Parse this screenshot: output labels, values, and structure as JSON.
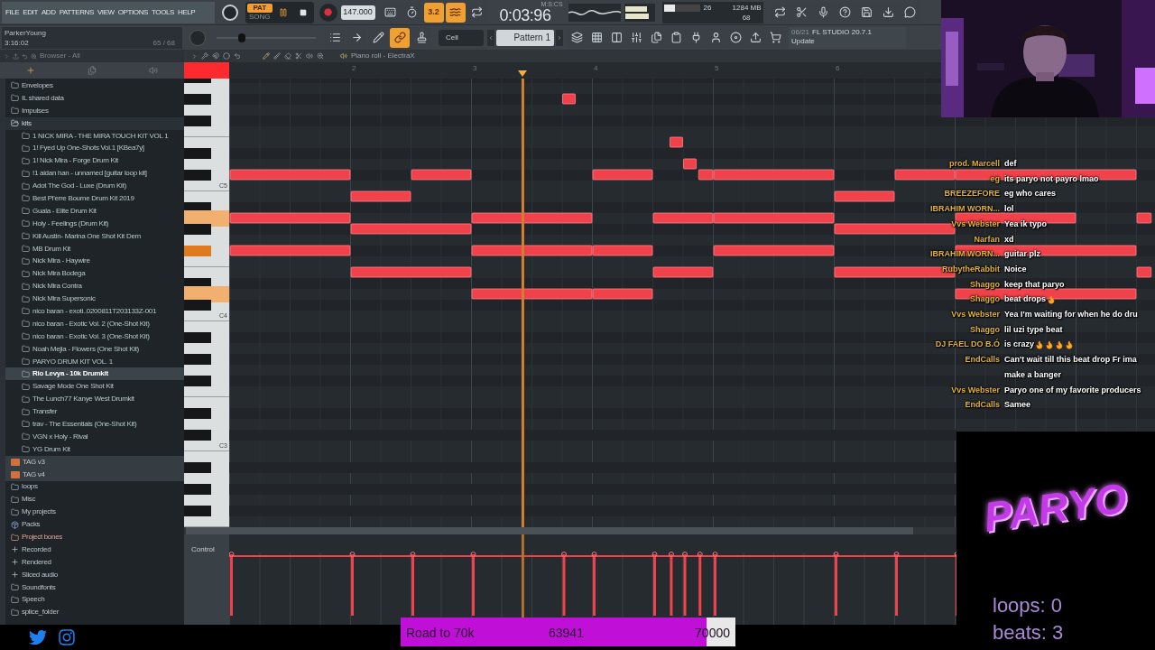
{
  "menu": [
    "FILE",
    "EDIT",
    "ADD",
    "PATTERNS",
    "VIEW",
    "OPTIONS",
    "TOOLS",
    "HELP"
  ],
  "transport": {
    "modes": [
      {
        "label": "PAT",
        "selected": true
      },
      {
        "label": "SONG",
        "selected": false
      }
    ],
    "playing": true,
    "recording": false,
    "tempo": "147.000",
    "time": "0:03:96",
    "time_unit": "M:S:CS"
  },
  "toolbar_left": [
    {
      "on": false
    },
    {
      "on": false
    },
    {
      "label": "3.2",
      "on": true
    },
    {
      "on": true
    },
    {
      "on": false
    }
  ],
  "cpu": {
    "level": 0.3,
    "cpu_value": "26",
    "memory": "1284 MB",
    "polyphony": "68"
  },
  "toolbar_right": [
    {
      "on": false
    },
    {
      "on": false
    },
    {
      "on": false
    },
    {
      "on": false
    },
    {
      "on": false
    },
    {
      "on": false
    },
    {
      "on": false
    }
  ],
  "hint": {
    "user": "ParkerYoung",
    "time": "3:16:02",
    "count": "65 / 68"
  },
  "pitch_slider": {
    "level": 0.25
  },
  "toolbar_row2": [
    {
      "on": false
    },
    {
      "on": false
    },
    {
      "on": false
    },
    {
      "on": true
    },
    {
      "on": false
    }
  ],
  "snap": "Cell",
  "pattern": "Pattern 1",
  "toolbar_row2_right": [
    {
      "on": false
    },
    {
      "on": false
    },
    {
      "on": false
    },
    {
      "on": false
    },
    {
      "on": false
    },
    {
      "on": false
    },
    {
      "on": false
    },
    {
      "on": false
    },
    {
      "on": false
    },
    {
      "on": false
    },
    {
      "on": false
    }
  ],
  "news": {
    "date": "06/21",
    "title": "FL STUDIO 20.7.1",
    "action": "Update"
  },
  "browser": {
    "title": "Browser - All",
    "items": [
      {
        "label": "Envelopes",
        "kind": "folder",
        "selected": false,
        "expanded": false
      },
      {
        "label": "IL shared data",
        "kind": "folder",
        "selected": false,
        "expanded": false
      },
      {
        "label": "Impulses",
        "kind": "folder",
        "selected": false,
        "expanded": false
      },
      {
        "label": "kits",
        "kind": "folder",
        "selected": false,
        "expanded": true,
        "children": [
          {
            "label": "1 NICK MIRA - THE MIRA TOUCH KIT VOL 1",
            "kind": "folder",
            "selected": false
          },
          {
            "label": "1! Fyed Up One-Shots Vol.1 [KBea7y]",
            "kind": "folder",
            "selected": false
          },
          {
            "label": "1! Nick Mira - Forge Drum Kit",
            "kind": "folder",
            "selected": false
          },
          {
            "label": "!1 aidan han - unnamed [guitar loop kit]",
            "kind": "folder",
            "selected": false
          },
          {
            "label": "Adot The God - Luxe (Drum Kit)",
            "kind": "folder",
            "selected": false
          },
          {
            "label": "Best Pi'erre Bourne Drum Kit 2019",
            "kind": "folder",
            "selected": false
          },
          {
            "label": "Guala - Elite Drum Kit",
            "kind": "folder",
            "selected": false
          },
          {
            "label": "Holy - Feelings (Drum Kit)",
            "kind": "folder",
            "selected": false
          },
          {
            "label": "Kill Austin- Marina One Shot Kit Dem",
            "kind": "folder",
            "selected": false
          },
          {
            "label": "MB Drum Kit",
            "kind": "folder",
            "selected": false
          },
          {
            "label": "Nick Mira - Haywire",
            "kind": "folder",
            "selected": false
          },
          {
            "label": "Nick Mira Bodega",
            "kind": "folder",
            "selected": false
          },
          {
            "label": "Nick Mira Contra",
            "kind": "folder",
            "selected": false
          },
          {
            "label": "Nick Mira Supersonic",
            "kind": "folder",
            "selected": false
          },
          {
            "label": "nico baran - exoti..0200811T203133Z-001",
            "kind": "folder",
            "selected": false
          },
          {
            "label": "nico baran - Exotic Vol. 2 (One-Shot Kit)",
            "kind": "folder",
            "selected": false
          },
          {
            "label": "nico baran - Exotic Vol. 3 (One-Shot Kit)",
            "kind": "folder",
            "selected": false
          },
          {
            "label": "Noah Mejia - Flowers (One Shot Kit)",
            "kind": "folder",
            "selected": false
          },
          {
            "label": "PARYO DRUM KIT VOL. 1",
            "kind": "folder",
            "selected": false
          },
          {
            "label": "Rio Levya - 10k Drumkit",
            "kind": "folder",
            "selected": true
          },
          {
            "label": "Savage Mode One Shot Kit",
            "kind": "folder",
            "selected": false
          },
          {
            "label": "The Lunch77 Kanye West Drumkit",
            "kind": "folder",
            "selected": false
          },
          {
            "label": "Transfer",
            "kind": "folder",
            "selected": false
          },
          {
            "label": "trav - The Essentials (One-Shot Kit)",
            "kind": "folder",
            "selected": false
          },
          {
            "label": "VGN x Holy - Rival",
            "kind": "folder",
            "selected": false
          },
          {
            "label": "YG Drum Kit",
            "kind": "folder",
            "selected": false
          }
        ]
      },
      {
        "label": "TAG v3",
        "kind": "audio",
        "selected": false
      },
      {
        "label": "TAG v4",
        "kind": "audio",
        "selected": false
      },
      {
        "label": "loops",
        "kind": "folder",
        "selected": false,
        "expanded": false
      },
      {
        "label": "Misc",
        "kind": "folder",
        "selected": false,
        "expanded": false
      },
      {
        "label": "My projects",
        "kind": "folder",
        "selected": false,
        "expanded": false
      },
      {
        "label": "Packs",
        "kind": "pack",
        "selected": false
      },
      {
        "label": "Project bones",
        "kind": "bones",
        "selected": false
      },
      {
        "label": "Recorded",
        "kind": "plus",
        "selected": false
      },
      {
        "label": "Rendered",
        "kind": "plus",
        "selected": false
      },
      {
        "label": "Sliced audio",
        "kind": "plus",
        "selected": false
      },
      {
        "label": "Soundfonts",
        "kind": "folder",
        "selected": false,
        "expanded": false
      },
      {
        "label": "Speech",
        "kind": "folder",
        "selected": false,
        "expanded": false
      },
      {
        "label": "splice_folder",
        "kind": "folder",
        "selected": false,
        "expanded": false
      }
    ]
  },
  "piano_roll": {
    "title": "Piano roll - ElectraX",
    "control_label": "Control",
    "bars": [
      "2",
      "3",
      "4",
      "5",
      "6"
    ],
    "octave_labels": [
      "C5",
      "C4",
      "C3"
    ]
  },
  "chat": [
    {
      "user": "prod. Marcell",
      "message": "def"
    },
    {
      "user": "eg",
      "message": "its paryo not payro lmao"
    },
    {
      "user": "BREEZEFORE",
      "message": "eg who cares"
    },
    {
      "user": "IBRAHIM WORN...",
      "message": "lol"
    },
    {
      "user": "Vvs Webster",
      "message": "Yea ik typo"
    },
    {
      "user": "Narfan",
      "message": "xd"
    },
    {
      "user": "IBRAHIM WORN...",
      "message": "guitar plz"
    },
    {
      "user": "RubytheRabbit",
      "message": "Noice"
    },
    {
      "user": "Shaggo",
      "message": "keep that paryo"
    },
    {
      "user": "Shaggo",
      "message": "beat drops",
      "reactions": [
        {
          "kind": "flame"
        }
      ]
    },
    {
      "user": "Vvs Webster",
      "message": "Yea I'm waiting for when he do dru"
    },
    {
      "user": "Shaggo",
      "message": "lil uzi type beat"
    },
    {
      "user": "DJ FAEL DO B.Ó",
      "message": "is crazy",
      "reactions": [
        {
          "kind": "flame"
        },
        {
          "kind": "flame"
        },
        {
          "kind": "flame"
        },
        {
          "kind": "flame"
        }
      ]
    },
    {
      "user": "EndCalls",
      "message": "Can't wait till this beat drop Fr ima make a banger"
    },
    {
      "user": "Vvs Webster",
      "message": "Paryo one of my favorite producers"
    },
    {
      "user": "EndCalls",
      "message": "Samee"
    }
  ],
  "overlay": {
    "logo": "PARYO",
    "counters": [
      "loops: 0",
      "beats: 3"
    ],
    "goal": {
      "title": "Road to 70k",
      "current": "63941",
      "target": "70000",
      "level": 0.913
    }
  }
}
